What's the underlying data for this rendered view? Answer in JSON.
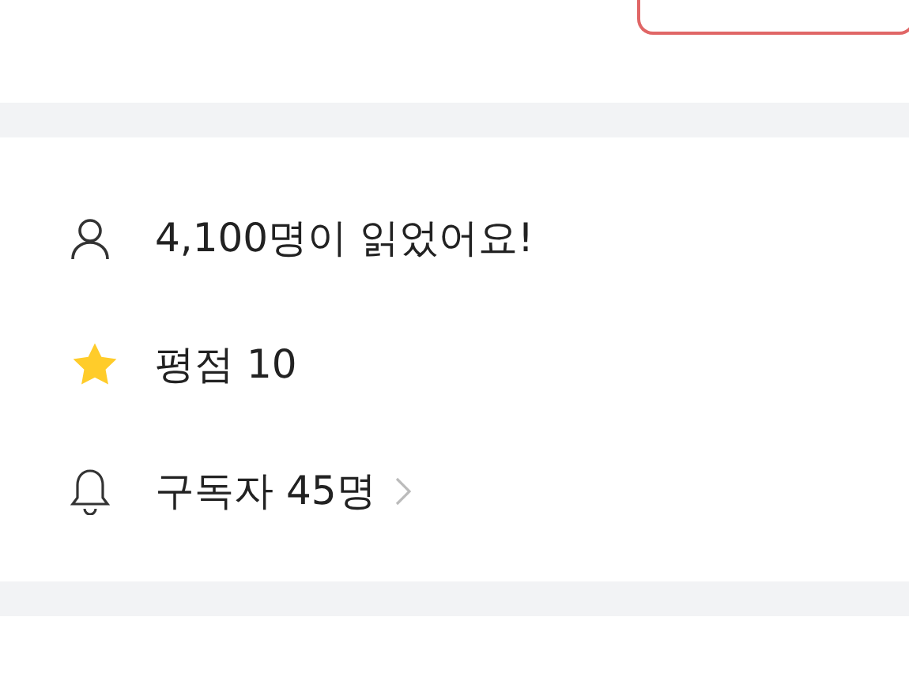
{
  "stats": [
    {
      "kind": "readers",
      "text": "4,100명이 읽었어요!",
      "link": false
    },
    {
      "kind": "rating",
      "text": "평점 10",
      "link": false
    },
    {
      "kind": "subscribers",
      "text": "구독자 45명",
      "link": true
    }
  ]
}
